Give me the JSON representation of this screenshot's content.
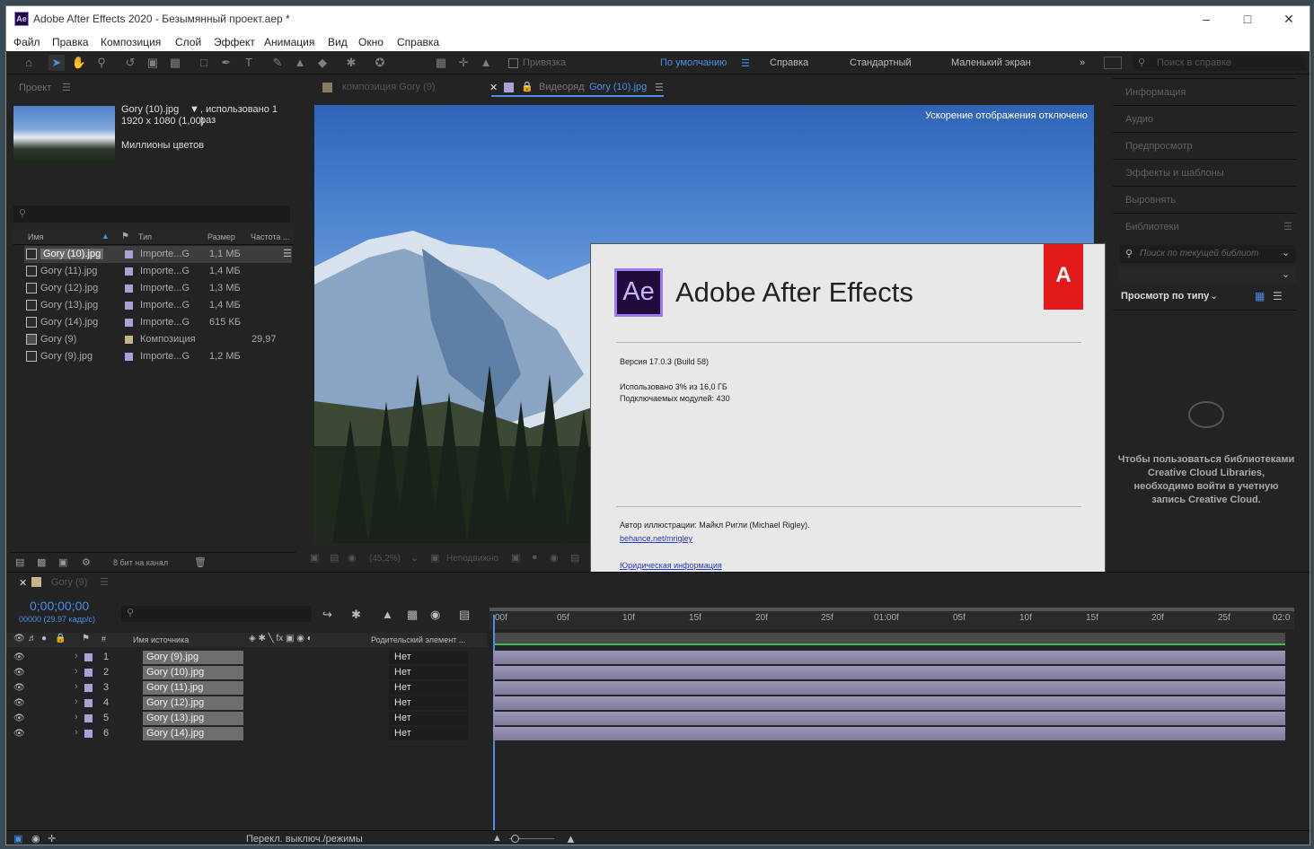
{
  "window": {
    "title": "Adobe After Effects 2020 - Безымянный проект.aep *",
    "app_icon": "Ae"
  },
  "menu": [
    "Файл",
    "Правка",
    "Композиция",
    "Слой",
    "Эффект",
    "Анимация",
    "Вид",
    "Окно",
    "Справка"
  ],
  "toolbar": {
    "snap_label": "Привязка",
    "workspaces": [
      "По умолчанию",
      "Справка",
      "Стандартный",
      "Маленький экран"
    ],
    "active_workspace": "По умолчанию",
    "search_placeholder": "Поиск в справке"
  },
  "project": {
    "tab": "Проект",
    "selected_name": "Gory (10).jpg",
    "used": ", использовано 1 раз",
    "dims": "1920 x 1080 (1,00)",
    "colors": "Миллионы цветов",
    "columns": [
      "Имя",
      "Тип",
      "Размер",
      "Частота ..."
    ],
    "items": [
      {
        "name": "Gory (10).jpg",
        "type": "Importe...G",
        "size": "1,1 МБ",
        "fps": "",
        "color": "#a8a3d6",
        "selected": true
      },
      {
        "name": "Gory (11).jpg",
        "type": "Importe...G",
        "size": "1,4 МБ",
        "fps": "",
        "color": "#a8a3d6"
      },
      {
        "name": "Gory (12).jpg",
        "type": "Importe...G",
        "size": "1,3 МБ",
        "fps": "",
        "color": "#a8a3d6"
      },
      {
        "name": "Gory (13).jpg",
        "type": "Importe...G",
        "size": "1,4 МБ",
        "fps": "",
        "color": "#a8a3d6"
      },
      {
        "name": "Gory (14).jpg",
        "type": "Importe...G",
        "size": "615 КБ",
        "fps": "",
        "color": "#a8a3d6"
      },
      {
        "name": "Gory (9)",
        "type": "Композиция",
        "size": "",
        "fps": "29,97",
        "color": "#c8b48a"
      },
      {
        "name": "Gory (9).jpg",
        "type": "Importe...G",
        "size": "1,2 МБ",
        "fps": "",
        "color": "#a8a3d6"
      }
    ],
    "bit_depth": "8 бит на канал"
  },
  "viewer": {
    "comp_tab": "композиция Gory (9)",
    "footage_tab_prefix": "Видеоряд",
    "footage_tab_name": "Gory (10).jpg",
    "notice": "Ускорение отображения отключено",
    "zoom": "(45,2%)",
    "status": "Неподвижно"
  },
  "about": {
    "product": "Adobe After Effects",
    "logo": "Ae",
    "version": "Версия 17.0.3 (Build 58)",
    "used": "Использовано 3% из 16,0 ГБ",
    "plugins": "Подключаемых модулей: 430",
    "author": "Автор иллюстрации: Майкл Ригли (Michael Rigley).",
    "link": "behance.net/mrigley",
    "legal": "Юридическая информация"
  },
  "right_panel": {
    "items": [
      "Информация",
      "Аудио",
      "Предпросмотр",
      "Эффекты и шаблоны",
      "Выровнять",
      "Библиотеки"
    ],
    "lib_search_placeholder": "Поиск по текущей библиот",
    "view_by": "Просмотр по типу",
    "message": "Чтобы пользоваться библиотеками Creative Cloud Libraries, необходимо войти в учетную запись Creative Cloud."
  },
  "timeline": {
    "comp_tab": "Gory (9)",
    "timecode": "0;00;00;00",
    "frames": "00000 (29.97 кадр/с)",
    "col_source": "Имя источника",
    "col_parent": "Родительский элемент ...",
    "ruler": [
      "00f",
      "05f",
      "10f",
      "15f",
      "20f",
      "25f",
      "01:00f",
      "05f",
      "10f",
      "15f",
      "20f",
      "25f",
      "02:0"
    ],
    "layers": [
      {
        "num": "1",
        "name": "Gory (9).jpg",
        "parent": "Нет"
      },
      {
        "num": "2",
        "name": "Gory (10).jpg",
        "parent": "Нет"
      },
      {
        "num": "3",
        "name": "Gory (11).jpg",
        "parent": "Нет"
      },
      {
        "num": "4",
        "name": "Gory (12).jpg",
        "parent": "Нет"
      },
      {
        "num": "5",
        "name": "Gory (13).jpg",
        "parent": "Нет"
      },
      {
        "num": "6",
        "name": "Gory (14).jpg",
        "parent": "Нет"
      }
    ],
    "mode_toggle": "Перекл. выключ./режимы"
  }
}
